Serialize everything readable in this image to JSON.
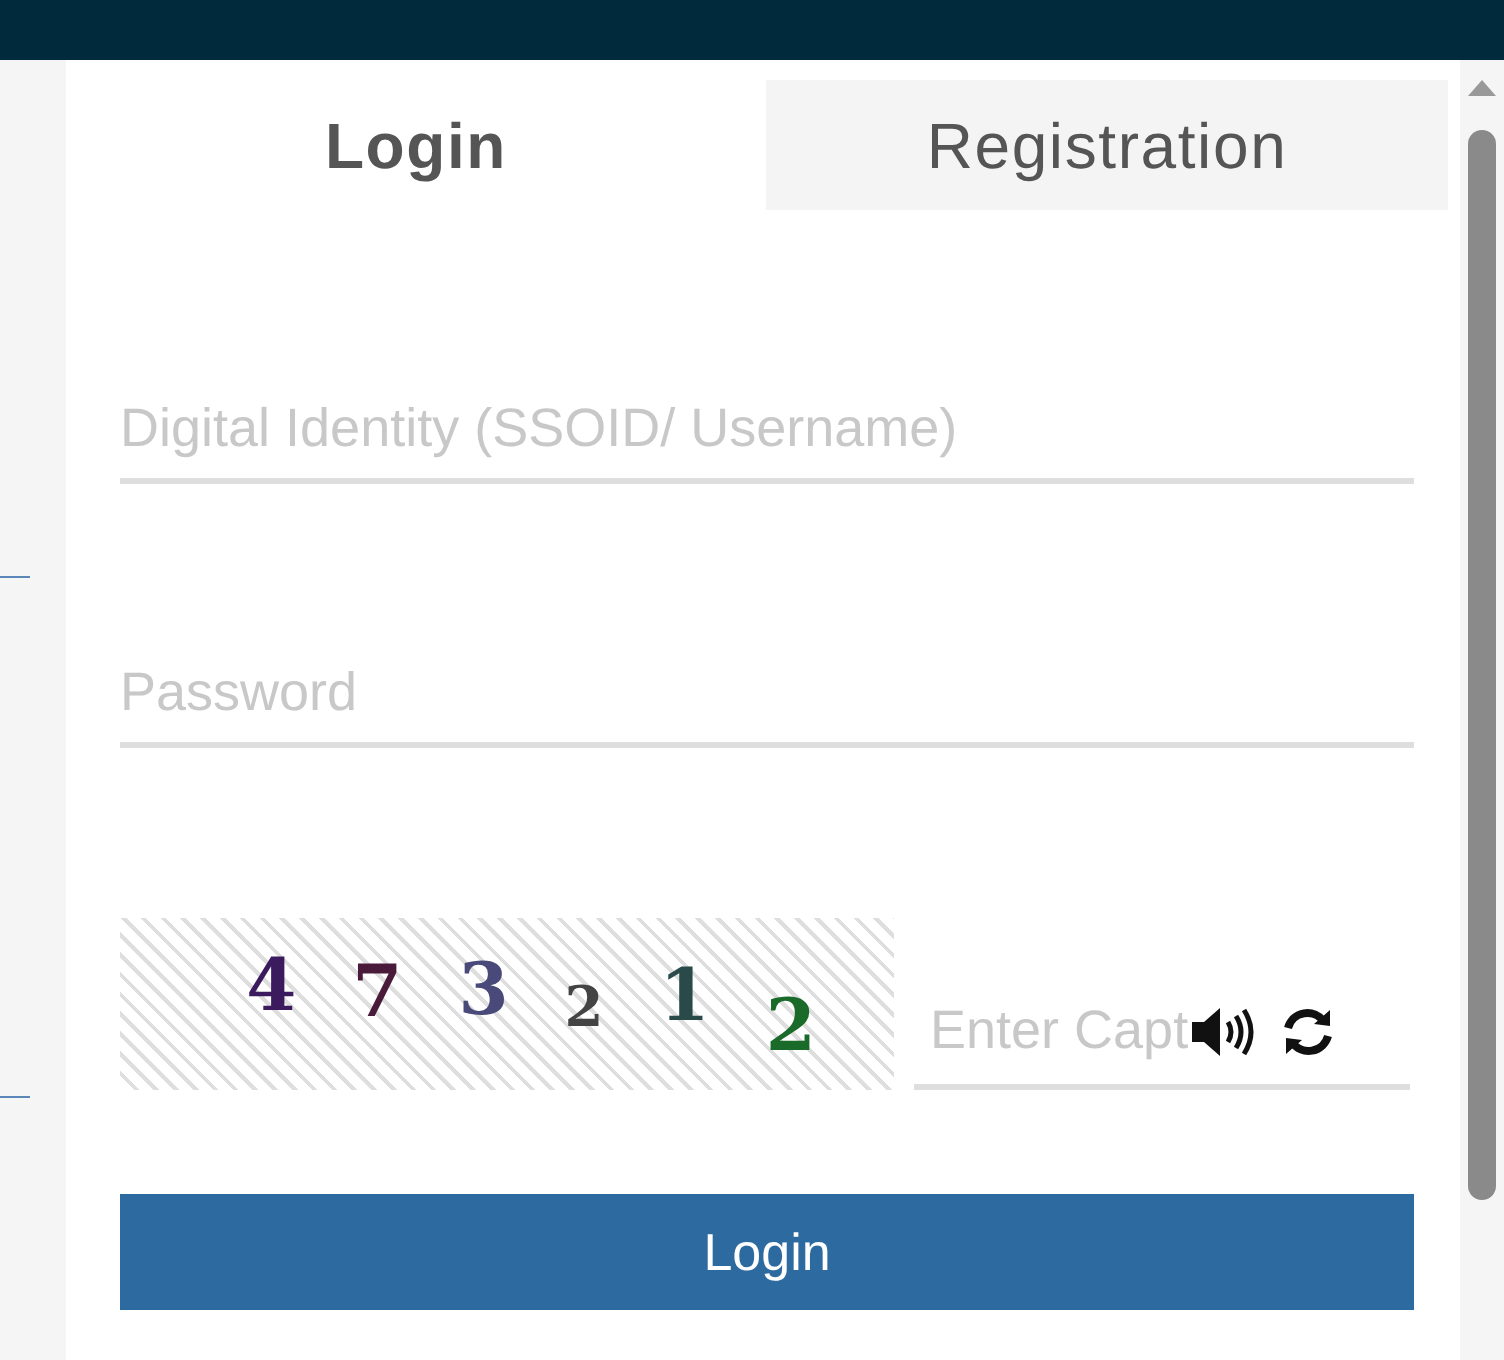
{
  "tabs": [
    {
      "label": "Login",
      "selected": true
    },
    {
      "label": "Registration",
      "selected": false
    }
  ],
  "fields": [
    {
      "placeholder": "Digital Identity (SSOID/ Username)"
    },
    {
      "placeholder": "Password"
    }
  ],
  "captcha": {
    "chars": [
      {
        "text": "4",
        "color": "#3b1a5e"
      },
      {
        "text": "7",
        "color": "#4a1a3a"
      },
      {
        "text": "3",
        "color": "#4a4a7a"
      },
      {
        "text": "2",
        "color": "#444444"
      },
      {
        "text": "1",
        "color": "#2a4a4a"
      },
      {
        "text": "2",
        "color": "#1a6a2a"
      }
    ],
    "placeholder": "Enter Capt"
  },
  "submit": "Login"
}
